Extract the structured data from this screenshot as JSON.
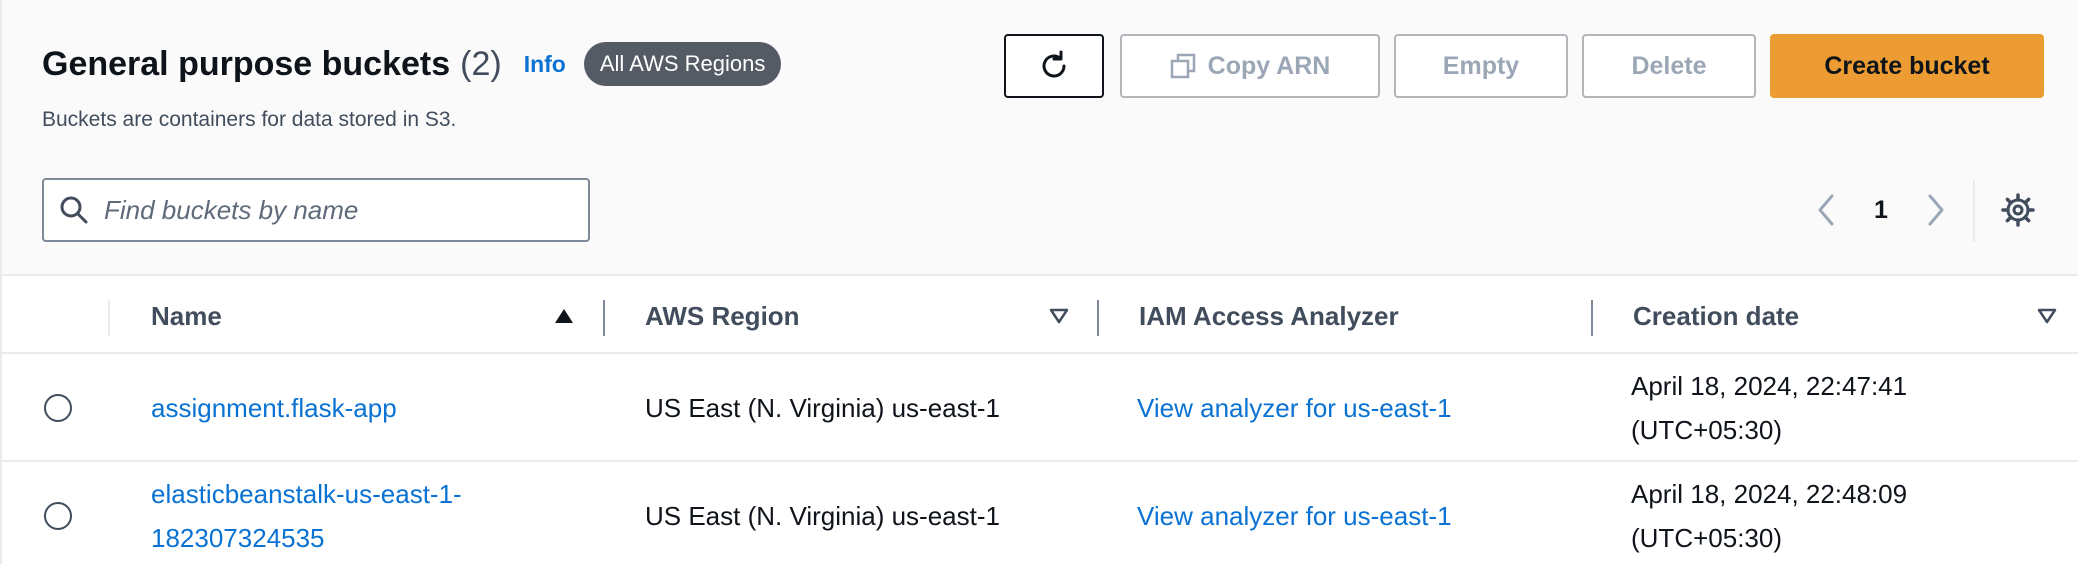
{
  "header": {
    "title": "General purpose buckets",
    "count": "(2)",
    "info_label": "Info",
    "region_badge": "All AWS Regions",
    "subtitle": "Buckets are containers for data stored in S3."
  },
  "toolbar": {
    "copy_arn_label": "Copy ARN",
    "empty_label": "Empty",
    "delete_label": "Delete",
    "create_label": "Create bucket"
  },
  "search": {
    "placeholder": "Find buckets by name",
    "value": ""
  },
  "pagination": {
    "current_page": "1"
  },
  "table": {
    "columns": [
      "Name",
      "AWS Region",
      "IAM Access Analyzer",
      "Creation date"
    ],
    "rows": [
      {
        "name_line1": "assignment.flask-app",
        "name_line2": "",
        "region": "US East (N. Virginia) us-east-1",
        "analyzer": "View analyzer for us-east-1",
        "date_line1": "April 18, 2024, 22:47:41",
        "date_line2": "(UTC+05:30)"
      },
      {
        "name_line1": "elasticbeanstalk-us-east-1-",
        "name_line2": "182307324535",
        "region": "US East (N. Virginia) us-east-1",
        "analyzer": "View analyzer for us-east-1",
        "date_line1": "April 18, 2024, 22:48:09",
        "date_line2": "(UTC+05:30)"
      }
    ]
  },
  "icons": {
    "refresh": "refresh-icon",
    "copy": "copy-icon",
    "search": "search-icon",
    "prev": "chevron-left-icon",
    "next": "chevron-right-icon",
    "settings": "gear-icon",
    "sort_asc": "caret-up-icon",
    "sort_desc": "caret-down-outline-icon"
  },
  "colors": {
    "primary_button": "#ec9c32",
    "link": "#0972d3",
    "badge": "#545b64"
  }
}
